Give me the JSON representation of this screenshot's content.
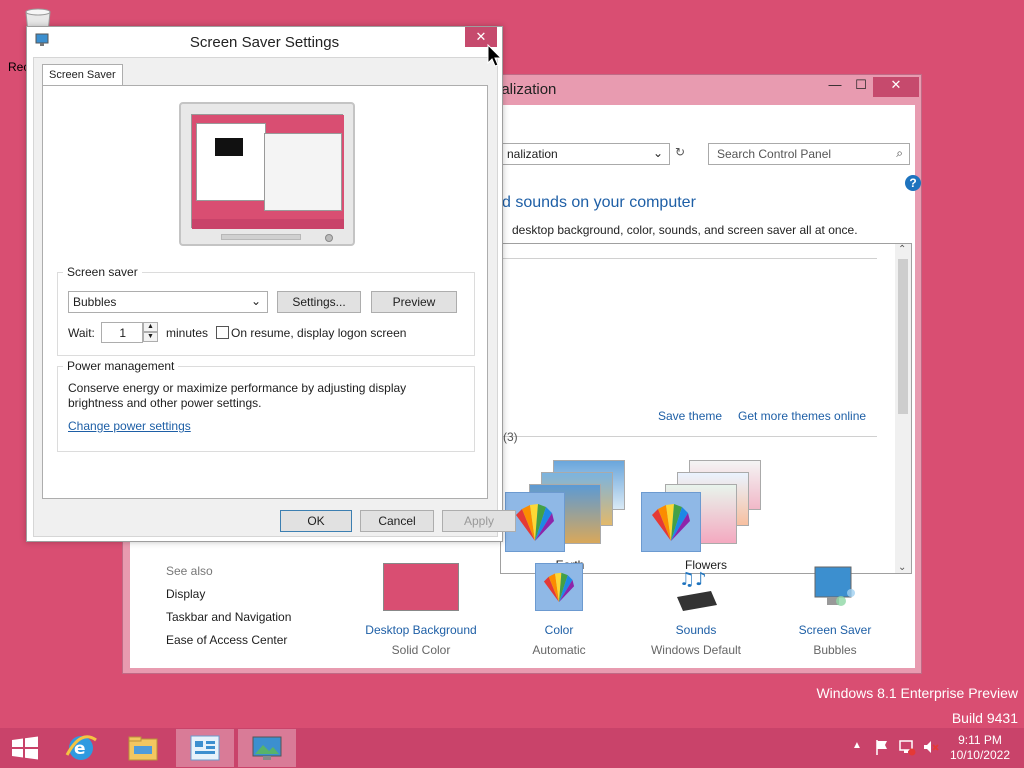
{
  "desktop": {
    "recycle_bin_label": "Rec",
    "watermark_line1": "Windows 8.1 Enterprise Preview",
    "watermark_line2": "Build 9431"
  },
  "personalization": {
    "title": "nalization",
    "address": "nalization",
    "search_placeholder": "Search Control Panel",
    "heading": "d sounds on your computer",
    "subtext": "desktop background, color, sounds, and screen saver all at once.",
    "save_theme": "Save theme",
    "get_more_themes": "Get more themes online",
    "installed_count": "(3)",
    "themes": [
      {
        "label": "Earth"
      },
      {
        "label": "Flowers"
      }
    ],
    "see_also": {
      "title": "See also",
      "links": [
        "Display",
        "Taskbar and Navigation",
        "Ease of Access Center"
      ]
    },
    "bottom_items": [
      {
        "label": "Desktop Background",
        "sub": "Solid Color",
        "color": "#d94e72"
      },
      {
        "label": "Color",
        "sub": "Automatic"
      },
      {
        "label": "Sounds",
        "sub": "Windows Default"
      },
      {
        "label": "Screen Saver",
        "sub": "Bubbles"
      }
    ]
  },
  "screensaver_dialog": {
    "title": "Screen Saver Settings",
    "tab": "Screen Saver",
    "screen_saver_group": "Screen saver",
    "selected_saver": "Bubbles",
    "settings_button": "Settings...",
    "preview_button": "Preview",
    "wait_label": "Wait:",
    "wait_value": "1",
    "minutes_label": "minutes",
    "resume_label": "On resume, display logon screen",
    "resume_checked": false,
    "power_group": "Power management",
    "power_text": "Conserve energy or maximize performance by adjusting display brightness and other power settings.",
    "power_link": "Change power settings",
    "ok": "OK",
    "cancel": "Cancel",
    "apply": "Apply"
  },
  "taskbar": {
    "time": "9:11 PM",
    "date": "10/10/2022"
  },
  "colors": {
    "desktop": "#d94e72",
    "accent_link": "#1e5fa6",
    "close_red": "#c64a6d"
  }
}
